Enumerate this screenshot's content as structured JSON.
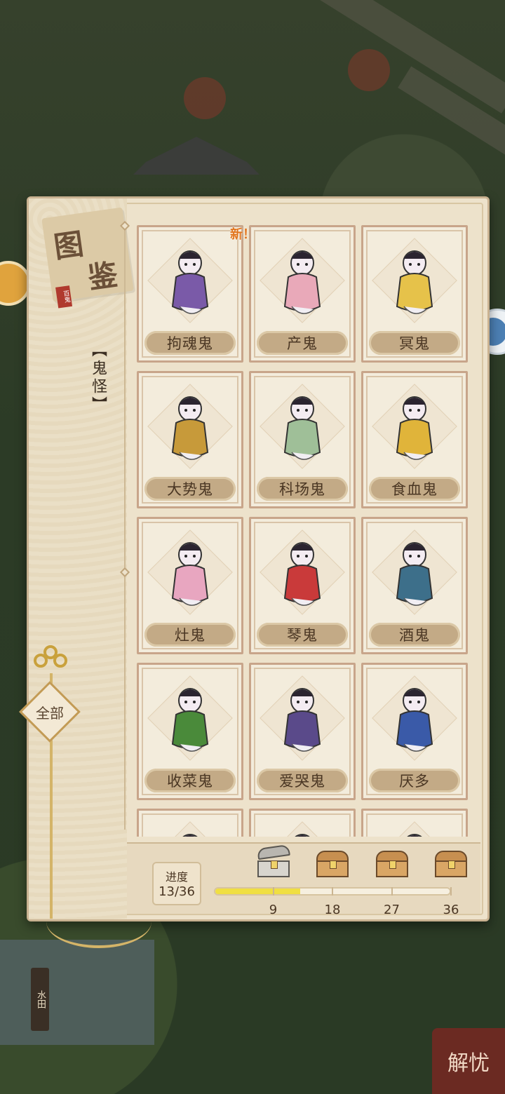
{
  "panel": {
    "title_chars": [
      "图",
      "鉴"
    ],
    "stamp_text": "百鬼",
    "category_label": "【鬼怪】",
    "filter_button": "全部",
    "new_badge": "新！"
  },
  "cards": [
    {
      "name": "拘魂鬼",
      "is_new": true,
      "color": "#7a5aa8"
    },
    {
      "name": "产鬼",
      "is_new": false,
      "color": "#e9a9b9"
    },
    {
      "name": "冥鬼",
      "is_new": false,
      "color": "#e6c24a"
    },
    {
      "name": "大势鬼",
      "is_new": false,
      "color": "#c79a3a"
    },
    {
      "name": "科场鬼",
      "is_new": false,
      "color": "#9fbf98"
    },
    {
      "name": "食血鬼",
      "is_new": false,
      "color": "#e0b43a"
    },
    {
      "name": "灶鬼",
      "is_new": false,
      "color": "#e8a6c0"
    },
    {
      "name": "琴鬼",
      "is_new": false,
      "color": "#c93a3a"
    },
    {
      "name": "酒鬼",
      "is_new": false,
      "color": "#3d6f8a"
    },
    {
      "name": "收菜鬼",
      "is_new": false,
      "color": "#4a8a3a"
    },
    {
      "name": "爱哭鬼",
      "is_new": false,
      "color": "#5a4a8a"
    },
    {
      "name": "厌多",
      "is_new": false,
      "color": "#3a5aa8"
    },
    {
      "name": "",
      "is_new": false,
      "color": "#d6b04a"
    },
    {
      "name": "",
      "is_new": false,
      "color": "#bdb7ad"
    },
    {
      "name": "",
      "is_new": false,
      "color": "#cfc9bf"
    }
  ],
  "progress": {
    "label": "进度",
    "value_text": "13/36",
    "current": 13,
    "max": 36,
    "milestones": [
      {
        "value": 9,
        "label": "9",
        "opened": true
      },
      {
        "value": 18,
        "label": "18",
        "opened": false
      },
      {
        "value": 27,
        "label": "27",
        "opened": false
      },
      {
        "value": 36,
        "label": "36",
        "opened": false
      }
    ]
  },
  "world": {
    "sign_text": "水田",
    "corner_button": "解忧"
  }
}
